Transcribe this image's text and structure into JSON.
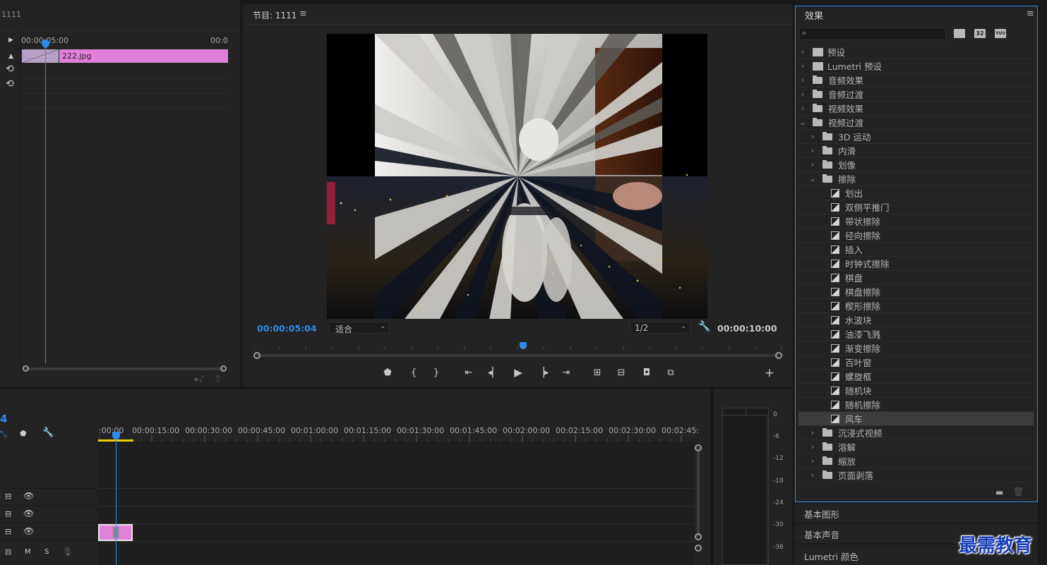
{
  "source_panel": {
    "title_fragment": "1111",
    "ruler_start": "00:00:05:00",
    "ruler_end": "00:0",
    "clip_name": "222.jpg"
  },
  "program_monitor": {
    "title": "节目: 1111",
    "current_time": "00:00:05:04",
    "zoom_fit": "适合",
    "resolution": "1/2",
    "duration": "00:00:10:00"
  },
  "timeline": {
    "sequence_time_fragment": "4",
    "ruler_labels": [
      ":00:00",
      "00:00:15:00",
      "00:00:30:00",
      "00:00:45:00",
      "00:01:00:00",
      "00:01:15:00",
      "00:01:30:00",
      "00:01:45:00",
      "00:02:00:00",
      "00:02:15:00",
      "00:02:30:00",
      "00:02:45:"
    ],
    "audio_track": {
      "m": "M",
      "s": "S"
    }
  },
  "audio_meter": {
    "scale": [
      "0",
      "-6",
      "-12",
      "-18",
      "-24",
      "-30",
      "-36"
    ]
  },
  "effects_panel": {
    "title": "效果",
    "search_placeholder": "",
    "filter_icons": [
      "accelerated-effects-icon",
      "32bit-icon",
      "yuv-icon"
    ],
    "filter_labels": [
      "32",
      "YUV"
    ],
    "top_items": [
      {
        "label": "预设",
        "kind": "preset"
      },
      {
        "label": "Lumetri 预设",
        "kind": "preset"
      },
      {
        "label": "音频效果",
        "kind": "folder"
      },
      {
        "label": "音频过渡",
        "kind": "folder"
      },
      {
        "label": "视频效果",
        "kind": "folder"
      },
      {
        "label": "视频过渡",
        "kind": "folder",
        "expanded": true
      }
    ],
    "transition_groups_before": [
      {
        "label": "3D 运动"
      },
      {
        "label": "内滑"
      },
      {
        "label": "划像"
      },
      {
        "label": "擦除",
        "expanded": true
      }
    ],
    "wipe_items": [
      "划出",
      "双侧平推门",
      "带状擦除",
      "径向擦除",
      "插入",
      "时钟式擦除",
      "棋盘",
      "棋盘擦除",
      "楔形擦除",
      "水波块",
      "油漆飞溅",
      "渐变擦除",
      "百叶窗",
      "螺旋框",
      "随机块",
      "随机擦除",
      "风车"
    ],
    "selected_item": "风车",
    "transition_groups_after": [
      {
        "label": "沉浸式视频"
      },
      {
        "label": "溶解"
      },
      {
        "label": "缩放"
      },
      {
        "label": "页面剥落"
      }
    ]
  },
  "collapsed_panels": [
    "基本图形",
    "基本声音",
    "Lumetri 颜色"
  ],
  "watermark": "最需教育",
  "colors": {
    "accent_blue": "#2d8ceb",
    "clip_pink": "#e080d8",
    "panel_bg": "#232323",
    "app_bg": "#1a1a1a"
  }
}
